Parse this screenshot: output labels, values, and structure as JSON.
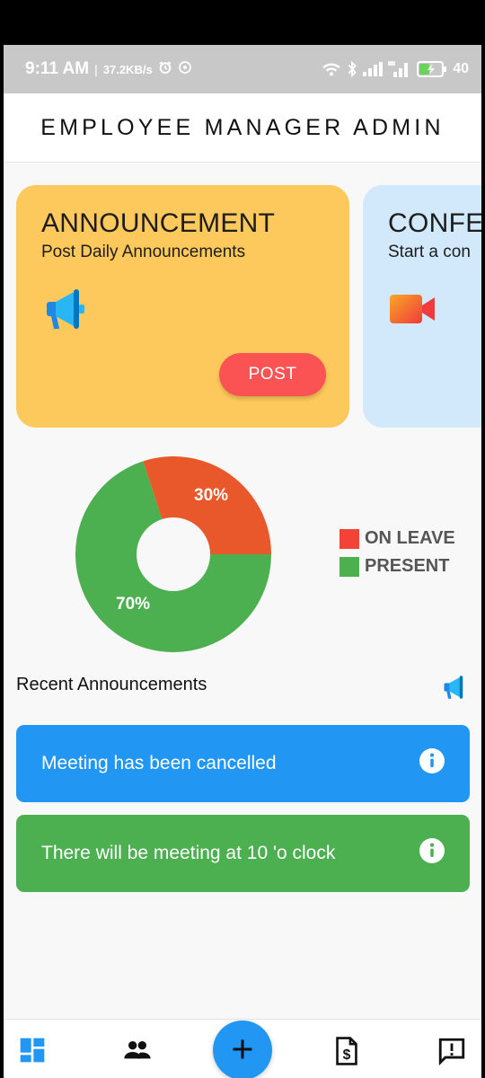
{
  "status_bar": {
    "time": "9:11 AM",
    "speed": "37.2KB/s",
    "battery_percent": "40",
    "icons": [
      "alarm-icon",
      "vpn-icon",
      "wifi-icon",
      "bluetooth-icon",
      "signal-icon",
      "signal-5g-icon",
      "battery-charging-icon"
    ]
  },
  "app_bar": {
    "title": "EMPLOYEE MANAGER ADMIN"
  },
  "cards": [
    {
      "title": "ANNOUNCEMENT",
      "subtitle": "Post Daily Announcements",
      "icon": "megaphone-icon",
      "button_label": "POST",
      "color": "#fec95c"
    },
    {
      "title": "CONFE",
      "subtitle": "Start a con",
      "icon": "video-camera-icon",
      "color": "#d2e8fb"
    }
  ],
  "chart_data": {
    "type": "pie",
    "categories": [
      "ON LEAVE",
      "PRESENT"
    ],
    "values": [
      30,
      70
    ],
    "labels": [
      "30%",
      "70%"
    ],
    "colors": [
      "#e9582a",
      "#4caf50"
    ],
    "legend_colors": [
      "#f44336",
      "#4caf50"
    ],
    "legend_position": "right"
  },
  "recent": {
    "title": "Recent Announcements",
    "icon": "megaphone-icon",
    "items": [
      {
        "text": "Meeting has been cancelled",
        "color": "#2196f3",
        "icon": "info-icon"
      },
      {
        "text": "There will be meeting at 10 'o clock",
        "color": "#4caf50",
        "icon": "info-icon"
      }
    ]
  },
  "bottom_nav": {
    "items": [
      "dashboard-icon",
      "people-icon",
      "add-icon",
      "payroll-icon",
      "feedback-icon"
    ],
    "accent": "#2196f3"
  }
}
